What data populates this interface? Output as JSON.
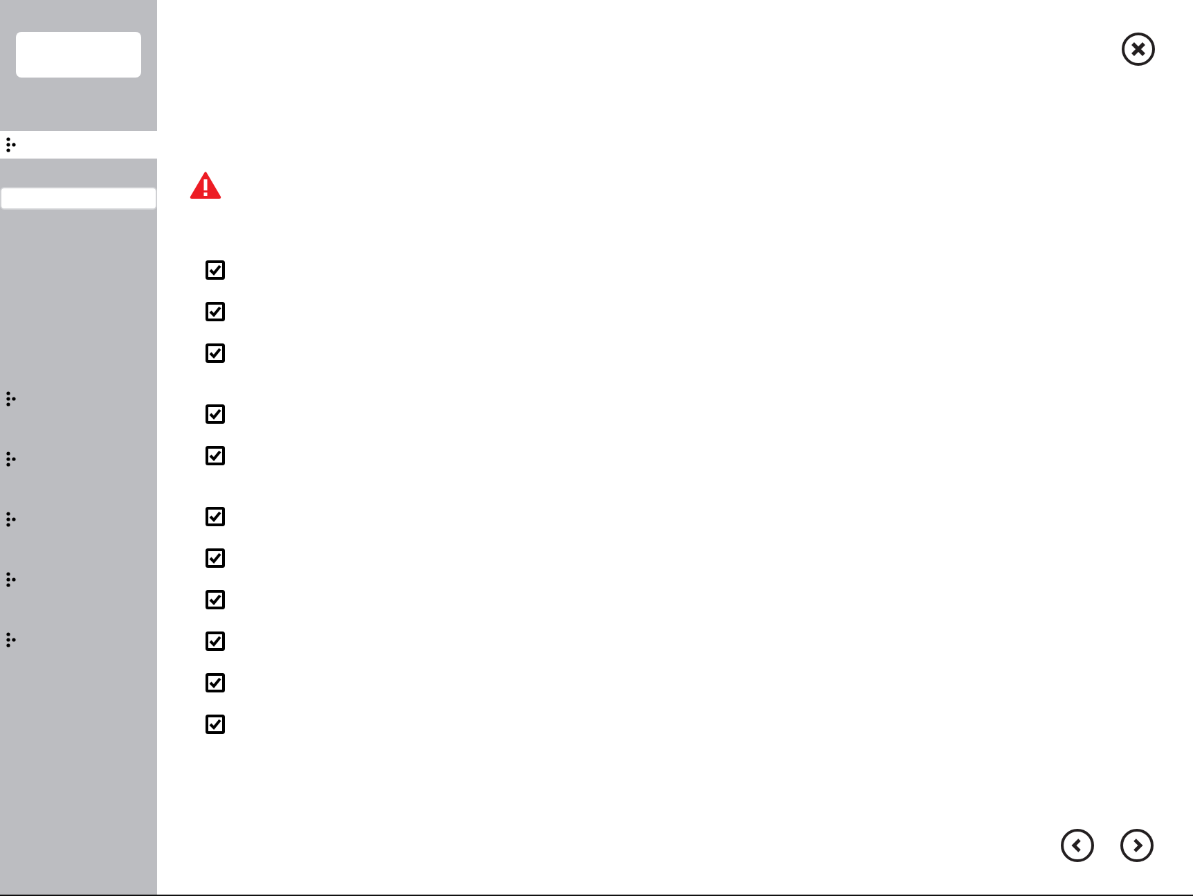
{
  "sidebar": {
    "top_items": [
      {
        "selected": true
      }
    ],
    "items": [
      {
        "selected": false
      },
      {
        "selected": false
      },
      {
        "selected": false
      },
      {
        "selected": false
      },
      {
        "selected": false
      }
    ]
  },
  "checklist": {
    "groups": [
      {
        "items": [
          {
            "checked": true
          },
          {
            "checked": true
          },
          {
            "checked": true
          }
        ]
      },
      {
        "items": [
          {
            "checked": true
          },
          {
            "checked": true
          }
        ]
      },
      {
        "items": [
          {
            "checked": true
          },
          {
            "checked": true
          },
          {
            "checked": true
          },
          {
            "checked": true
          },
          {
            "checked": true
          },
          {
            "checked": true
          }
        ]
      }
    ]
  }
}
